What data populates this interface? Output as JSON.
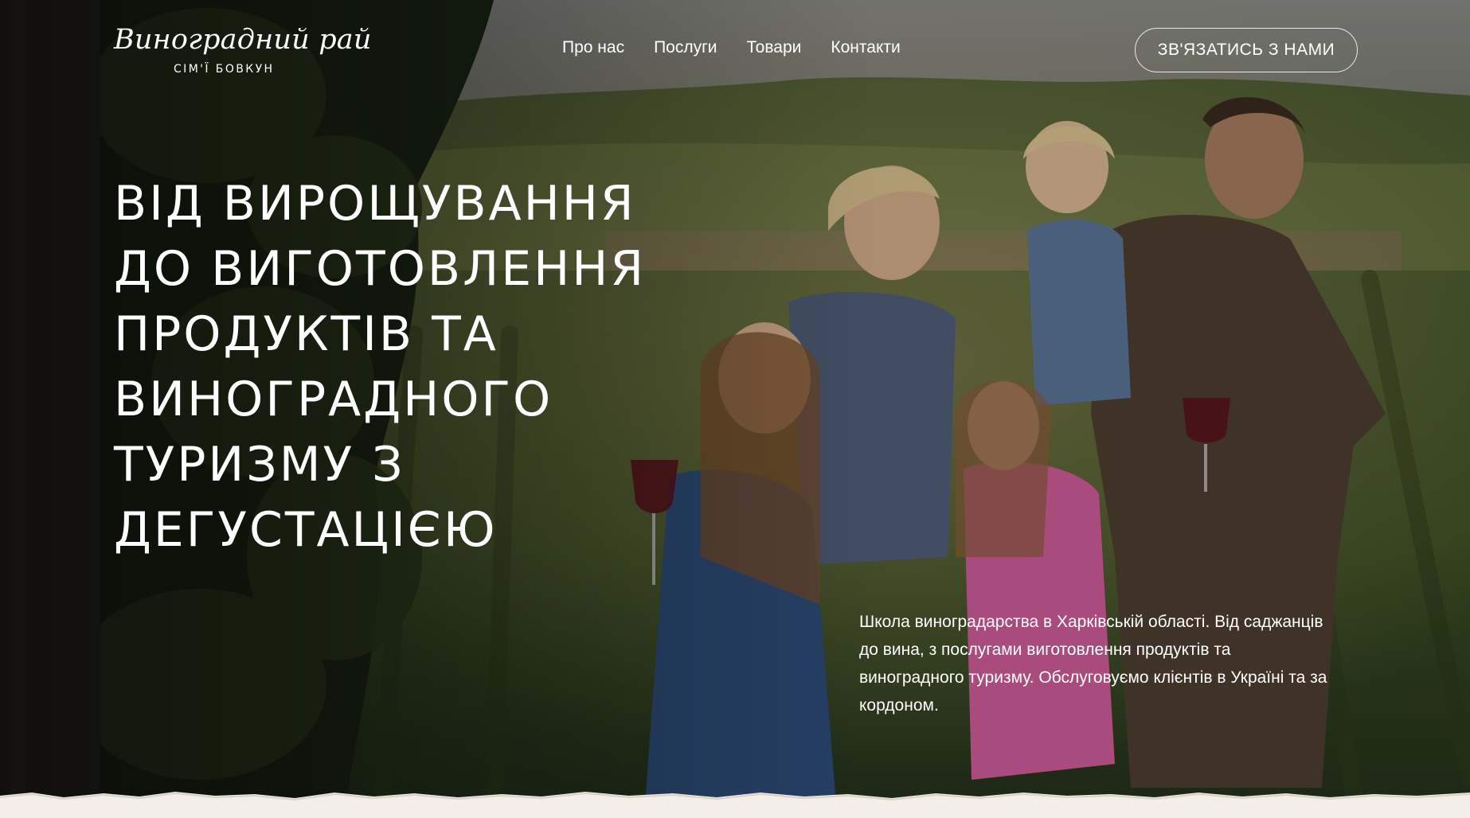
{
  "brand": {
    "logo_script": "Виноградний рай",
    "logo_sub": "СІМ'Ї БОВКУН"
  },
  "nav": {
    "items": [
      {
        "label": "Про нас"
      },
      {
        "label": "Послуги"
      },
      {
        "label": "Товари"
      },
      {
        "label": "Контакти"
      }
    ]
  },
  "cta": {
    "label": "ЗВ'ЯЗАТИСЬ З НАМИ"
  },
  "hero": {
    "headline_lines": [
      "ВІД ВИРОЩУВАННЯ",
      "ДО ВИГОТОВЛЕННЯ",
      "ПРОДУКТІВ ТА",
      "ВИНОГРАДНОГО",
      "ТУРИЗМУ З",
      "ДЕГУСТАЦІЄЮ"
    ],
    "lead": "Школа виноградарства в Харківській області. Від саджанців до вина, з послугами виготовлення продуктів та виноградного туризму. Обслуговуємо клієнтів в Україні та за кордоном."
  },
  "colors": {
    "text": "#ffffff",
    "paper": "#f3efe8",
    "sky": "#7d7e78",
    "foliage_dark": "#1f2a15",
    "foliage_mid": "#3f5527"
  }
}
